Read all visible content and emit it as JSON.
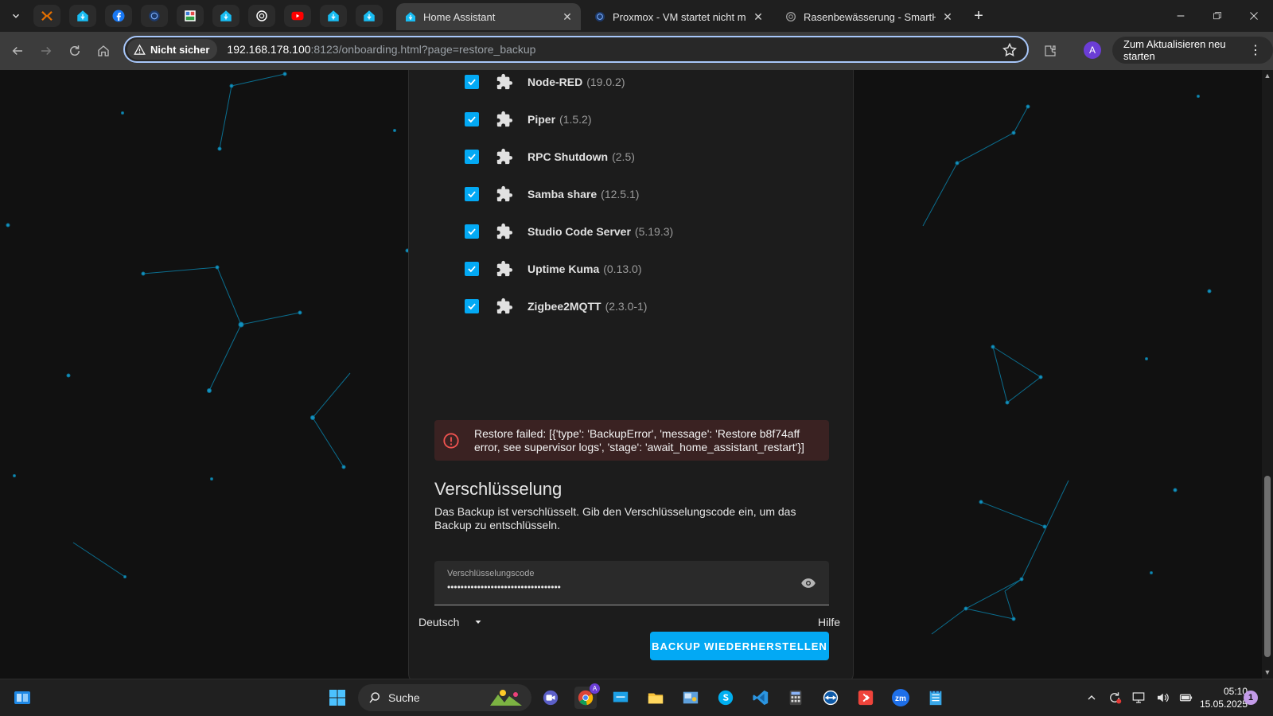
{
  "browser": {
    "tabs": [
      {
        "title": "Home Assistant",
        "active": true
      },
      {
        "title": "Proxmox - VM startet nicht mehr",
        "active": false
      },
      {
        "title": "Rasenbewässerung - SmartHome",
        "active": false
      }
    ],
    "new_tab_symbol": "+",
    "close_symbol": "✕",
    "security_chip": "Nicht sicher",
    "url_host": "192.168.178.100",
    "url_rest": ":8123/onboarding.html?page=restore_backup",
    "avatar_letter": "A",
    "restart_label": "Zum Aktualisieren neu starten",
    "restart_menu_symbol": "⋮"
  },
  "addons": [
    {
      "name": "Node-RED",
      "version": "(19.0.2)"
    },
    {
      "name": "Piper",
      "version": "(1.5.2)"
    },
    {
      "name": "RPC Shutdown",
      "version": "(2.5)"
    },
    {
      "name": "Samba share",
      "version": "(12.5.1)"
    },
    {
      "name": "Studio Code Server",
      "version": "(5.19.3)"
    },
    {
      "name": "Uptime Kuma",
      "version": "(0.13.0)"
    },
    {
      "name": "Zigbee2MQTT",
      "version": "(2.3.0-1)"
    }
  ],
  "alert": {
    "text": "Restore failed: [{'type': 'BackupError', 'message': 'Restore b8f74aff error, see supervisor logs', 'stage': 'await_home_assistant_restart'}]"
  },
  "encryption": {
    "title": "Verschlüsselung",
    "description": "Das Backup ist verschlüsselt. Gib den Verschlüsselungscode ein, um das Backup zu entschlüsseln.",
    "field_label": "Verschlüsselungscode",
    "masked_value": "••••••••••••••••••••••••••••••••••"
  },
  "restore_button": "BACKUP WIEDERHERSTELLEN",
  "footer": {
    "language": "Deutsch",
    "help": "Hilfe"
  },
  "taskbar": {
    "search_label": "Suche",
    "time": "05:10",
    "date": "15.05.2025",
    "notification_count": "1",
    "chrome_badge": "A"
  },
  "colors": {
    "accent": "#03a9f4",
    "error_bg": "#3a2222",
    "error_icon": "#ef5350",
    "card_bg": "#1c1c1c"
  }
}
